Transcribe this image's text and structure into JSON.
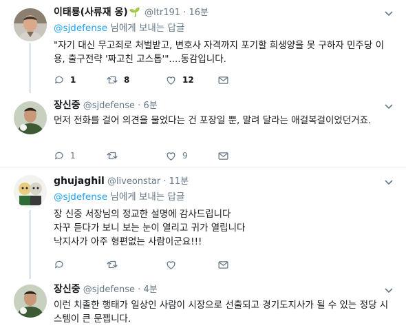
{
  "tweets": [
    {
      "name": "이태룡(사류재 옹)",
      "leaf": "🌱",
      "handle": "@ltr191",
      "sep": "·",
      "time": "16분",
      "reply_mention": "@sjdefense",
      "reply_suffix": " 님에게 보내는 답글",
      "text": "\"자기 대신 무고죄로 처벌받고, 변호사 자격까지 포기할 희생양을 못 구하자 민주당 이용, 출구전략 '짜고친 고스톱'\"....동감입니다.",
      "replies": "1",
      "retweets": "8",
      "likes": "12"
    },
    {
      "name": "장신중",
      "handle": "@sjdefense",
      "sep": "·",
      "time": "6분",
      "text": "먼저 전화를 걸어 의견을 물었다는 건 포장일 뿐, 말려 달라는 애걸복걸이었던거죠.",
      "replies": "1",
      "retweets": "",
      "likes": "9"
    },
    {
      "name": "ghujaghil",
      "handle": "@liveonstar",
      "sep": "·",
      "time": "11분",
      "reply_mention": "@sjdefense",
      "reply_suffix": " 님에게 보내는 답글",
      "text": "장 신중 서장님의  정교한 설명에 감사드립니다\n자꾸 듣다가 보니 보는 눈이 열리고 귀가 열립니다\n낙지사가 아주 형편없는 사람이군요!!!"
    },
    {
      "name": "장신중",
      "handle": "@sjdefense",
      "sep": "·",
      "time": "4분",
      "text": "이런 치졸한 행태가 일상인 사람이 시장으로 선출되고 경기도지사가 될 수 있는 정당 시스템이 큰 문젭니다."
    }
  ],
  "icons": {
    "reply": "reply-icon",
    "retweet": "retweet-icon",
    "like": "heart-icon",
    "dm": "envelope-icon",
    "caret": "chevron-down-icon"
  },
  "colors": {
    "link": "#1da1f2",
    "muted": "#657786",
    "text": "#14171a",
    "line": "#e1e8ed"
  }
}
